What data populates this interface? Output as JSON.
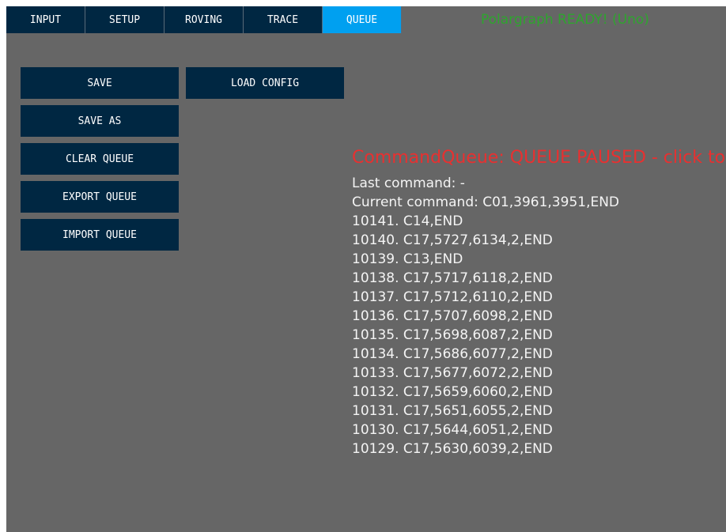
{
  "tabs": [
    {
      "label": "INPUT"
    },
    {
      "label": "SETUP"
    },
    {
      "label": "ROVING"
    },
    {
      "label": "TRACE"
    },
    {
      "label": "QUEUE"
    }
  ],
  "active_tab": "QUEUE",
  "status": {
    "text": "Polargraph READY! (Uno)",
    "color": "#2ea52e"
  },
  "buttons": {
    "save": "SAVE",
    "load_config": "LOAD CONFIG",
    "save_as": "SAVE AS",
    "clear_queue": "CLEAR QUEUE",
    "export_queue": "EXPORT QUEUE",
    "import_queue": "IMPORT QUEUE"
  },
  "queue": {
    "title": "CommandQueue: QUEUE PAUSED - click to start",
    "last_command": "Last command: -",
    "current_command": "Current command: C01,3961,3951,END",
    "commands": [
      "10141. C14,END",
      "10140. C17,5727,6134,2,END",
      "10139. C13,END",
      "10138. C17,5717,6118,2,END",
      "10137. C17,5712,6110,2,END",
      "10136. C17,5707,6098,2,END",
      "10135. C17,5698,6087,2,END",
      "10134. C17,5686,6077,2,END",
      "10133. C17,5677,6072,2,END",
      "10132. C17,5659,6060,2,END",
      "10131. C17,5651,6055,2,END",
      "10130. C17,5644,6051,2,END",
      "10129. C17,5630,6039,2,END"
    ]
  },
  "colors": {
    "background": "#666666",
    "tab_bg": "#002742",
    "tab_active": "#00a0f0",
    "title_red": "#e83030",
    "text": "#f4f4f4"
  }
}
